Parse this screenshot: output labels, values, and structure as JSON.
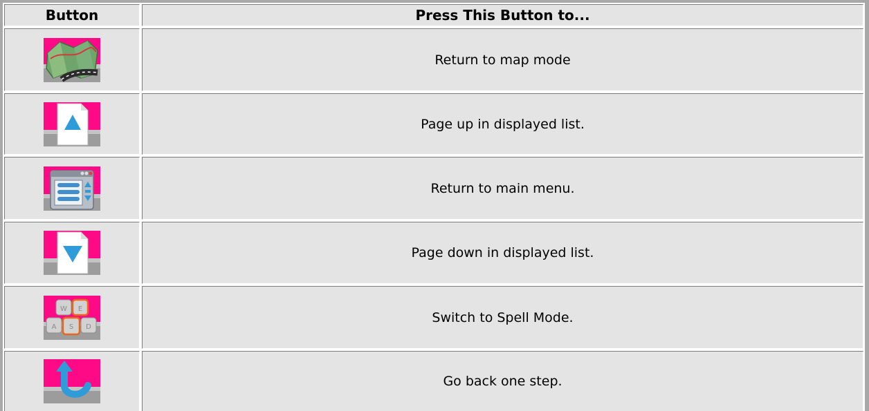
{
  "table": {
    "header": {
      "button_col": "Button",
      "action_col": "Press This Button to..."
    },
    "rows": [
      {
        "icon": "map-icon",
        "action": "Return to map mode"
      },
      {
        "icon": "page-up-icon",
        "action": "Page up in displayed list."
      },
      {
        "icon": "main-menu-icon",
        "action": "Return to main menu."
      },
      {
        "icon": "page-down-icon",
        "action": "Page down in displayed list."
      },
      {
        "icon": "keyboard-icon",
        "action": "Switch to Spell Mode.",
        "keys": [
          "W",
          "E",
          "A",
          "S",
          "D"
        ]
      },
      {
        "icon": "back-arrow-icon",
        "action": "Go back one step."
      }
    ]
  },
  "colors": {
    "icon_bg_magenta": "#ff0a86",
    "icon_bg_gray": "#9c9c9c",
    "cell_bg": "#e4e4e4",
    "arrow_blue": "#2f9bd9",
    "key_highlight_orange": "#e8671a"
  }
}
